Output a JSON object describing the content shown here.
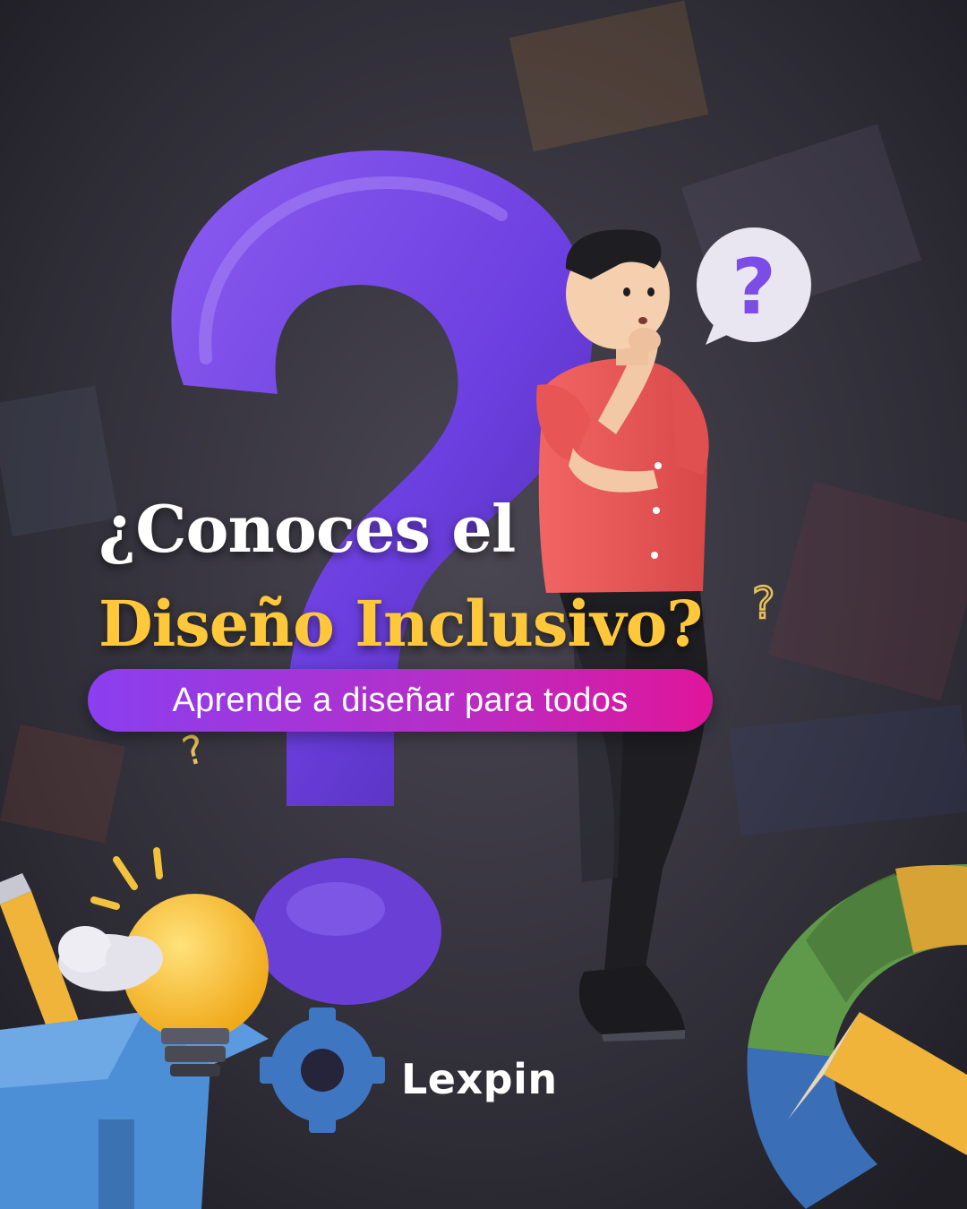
{
  "headline": {
    "line1": "¿Conoces el",
    "line2": "Diseño Inclusivo?"
  },
  "subtitle": "Aprende a diseñar para todos",
  "brand": "Lexpin",
  "speech_bubble_symbol": "?",
  "colors": {
    "background": "#2b2a33",
    "question_mark": "#7a45e6",
    "headline_accent": "#ffc83a",
    "pill_start": "#8a3ff0",
    "pill_end": "#e0159a",
    "shirt": "#ef5b5b"
  },
  "icons": [
    "question-mark-3d-icon",
    "thinking-person-icon",
    "speech-bubble-icon",
    "lightbulb-icon",
    "pencil-icon",
    "gear-icon",
    "cloud-icon",
    "color-wheel-icon",
    "open-box-icon"
  ]
}
